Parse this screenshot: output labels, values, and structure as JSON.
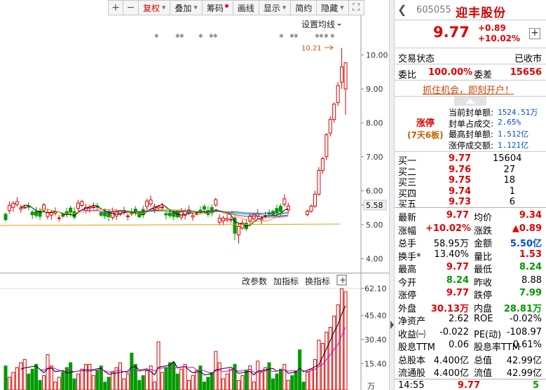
{
  "toolbar": {
    "plus": "+",
    "minus": "−",
    "items": [
      "复权",
      "叠加",
      "筹码",
      "画线",
      "显示",
      "简约",
      "隐藏"
    ],
    "expand": "⛶"
  },
  "chart": {
    "ma_setting": "设置均线",
    "high_label": "10.21",
    "price_ticks": [
      "10.00",
      "9.00",
      "8.00",
      "7.00",
      "6.00",
      "5.58",
      "5.00",
      "4.00"
    ],
    "sub_buttons": [
      "改参数",
      "加指标",
      "换指标"
    ],
    "vol_ticks": [
      "62.10",
      "45.40",
      "30.40",
      "15.40"
    ],
    "vol_unit": "万"
  },
  "stock": {
    "code": "605055",
    "name": "迎丰股份",
    "price": "9.77",
    "change": "+0.89",
    "change_pct": "+10.02%"
  },
  "status": {
    "label": "交易状态",
    "value": "已收市"
  },
  "ratio": {
    "wb_label": "委比",
    "wb_value": "100.00%",
    "wc_label": "委差",
    "wc_value": "15656"
  },
  "promo": "抓住机会，即刻开户！",
  "limit": {
    "title": "涨停",
    "days": "(7天6板)",
    "fields": [
      {
        "label": "当前封单额:",
        "value": "1524.51万"
      },
      {
        "label": "封单占成交:",
        "value": "2.65%"
      },
      {
        "label": "最高封单额:",
        "value": "1.512亿"
      },
      {
        "label": "涨停成交额:",
        "value": "1.121亿"
      }
    ]
  },
  "book": [
    {
      "label": "买一",
      "price": "9.77",
      "vol": "15604"
    },
    {
      "label": "买二",
      "price": "9.76",
      "vol": "27"
    },
    {
      "label": "买三",
      "price": "9.75",
      "vol": "18"
    },
    {
      "label": "买四",
      "price": "9.74",
      "vol": "1"
    },
    {
      "label": "买五",
      "price": "9.73",
      "vol": "6"
    }
  ],
  "stats": [
    {
      "l1": "最新",
      "v1": "9.77",
      "c1": "red",
      "l2": "均价",
      "v2": "9.34",
      "c2": "red"
    },
    {
      "l1": "涨幅",
      "v1": "+10.02%",
      "c1": "red",
      "l2": "涨跌",
      "v2": "▲0.89",
      "c2": "red"
    },
    {
      "l1": "总手",
      "v1": "58.95万",
      "c1": "black",
      "l2": "金额",
      "v2": "5.50亿",
      "c2": "blue"
    },
    {
      "l1": "换手*",
      "v1": "13.40%",
      "c1": "black",
      "l2": "量比",
      "v2": "1.53",
      "c2": "red"
    },
    {
      "l1": "最高",
      "v1": "9.77",
      "c1": "red",
      "l2": "最低",
      "v2": "8.24",
      "c2": "green"
    },
    {
      "l1": "今开",
      "v1": "8.24",
      "c1": "green",
      "l2": "昨收",
      "v2": "8.88",
      "c2": "black"
    },
    {
      "l1": "涨停",
      "v1": "9.77",
      "c1": "red",
      "l2": "跌停",
      "v2": "7.99",
      "c2": "green"
    },
    {
      "l1": "外盘",
      "v1": "30.13万",
      "c1": "red",
      "l2": "内盘",
      "v2": "28.81万",
      "c2": "green"
    },
    {
      "l1": "净资产",
      "v1": "2.62",
      "c1": "black",
      "l2": "ROE",
      "v2": "-0.02%",
      "c2": "black"
    },
    {
      "l1": "收益㈠",
      "v1": "-0.022",
      "c1": "black",
      "l2": "PE(动)",
      "v2": "-108.97",
      "c2": "black"
    },
    {
      "l1": "股息TTM",
      "v1": "0.06",
      "c1": "black",
      "l2": "股息率TTM",
      "v2": "0.61%",
      "c2": "black"
    },
    {
      "l1": "总股本",
      "v1": "4.400亿",
      "c1": "black",
      "l2": "总值",
      "v2": "42.99亿",
      "c2": "black"
    },
    {
      "l1": "流通股",
      "v1": "4.400亿",
      "c1": "black",
      "l2": "流值",
      "v2": "42.99亿",
      "c2": "black"
    }
  ],
  "tick": {
    "time": "14:55",
    "price": "9.77",
    "vol": "5"
  }
}
